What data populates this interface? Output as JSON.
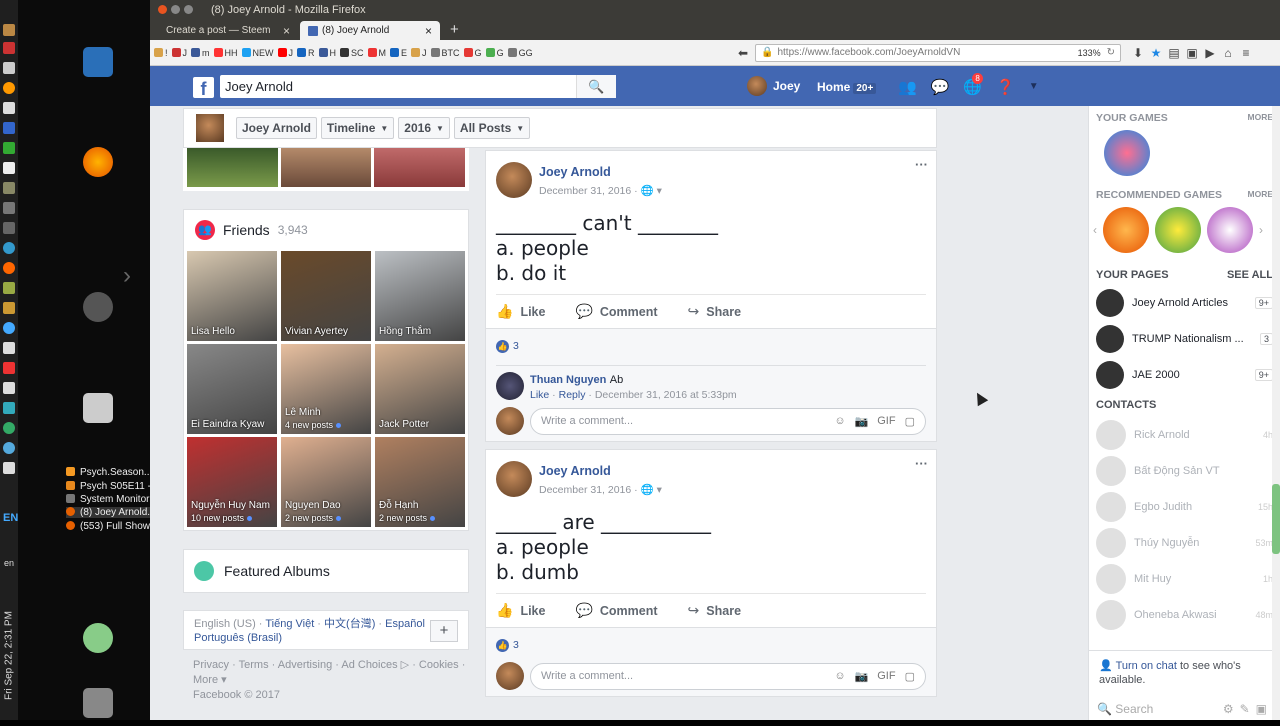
{
  "system": {
    "clock": "Fri Sep 22, 2:31 PM",
    "lang": "EN",
    "kb": "en"
  },
  "taskbar": {
    "items": [
      {
        "label": "Psych.Season....",
        "color": "#f59a23"
      },
      {
        "label": "Psych S05E11 -...",
        "color": "#e8891d"
      },
      {
        "label": "System Monitor",
        "color": "#777777"
      },
      {
        "label": "(8) Joey Arnold...",
        "color": "#e66000"
      },
      {
        "label": "(553) Full Show...",
        "color": "#e66000"
      }
    ]
  },
  "window": {
    "title": "(8) Joey Arnold - Mozilla Firefox"
  },
  "tabs": [
    {
      "label": "Create a post — Steem",
      "active": false
    },
    {
      "label": "(8) Joey Arnold",
      "active": true
    }
  ],
  "bookmarks": [
    "!",
    "J",
    "m",
    "HH",
    "NEW",
    "J",
    "R",
    "H",
    "SC",
    "M",
    "E",
    "J",
    "BTC",
    "G",
    "G",
    "GG"
  ],
  "url": {
    "value": "https://www.facebook.com/JoeyArnoldVN",
    "zoom": "133%"
  },
  "fb": {
    "search_value": "Joey Arnold",
    "user_name": "Joey",
    "home_label": "Home",
    "home_badge": "20+",
    "notif_count": "8"
  },
  "timeline": {
    "name": "Joey Arnold",
    "section": "Timeline",
    "year": "2016",
    "filter": "All Posts"
  },
  "friends": {
    "title": "Friends",
    "count": "3,943",
    "list": [
      {
        "name": "Lisa Hello",
        "note": ""
      },
      {
        "name": "Vivian Ayertey",
        "note": ""
      },
      {
        "name": "Hồng Thắm",
        "note": ""
      },
      {
        "name": "Ei Eaindra Kyaw",
        "note": ""
      },
      {
        "name": "Lê Minh",
        "note": "4 new posts"
      },
      {
        "name": "Jack Potter",
        "note": ""
      },
      {
        "name": "Nguyễn Huy Nam",
        "note": "10 new posts"
      },
      {
        "name": "Nguyen Dao",
        "note": "2 new posts"
      },
      {
        "name": "Đỗ Hạnh",
        "note": "2 new posts"
      }
    ]
  },
  "albums": {
    "title": "Featured Albums"
  },
  "languages": {
    "current": "English (US)",
    "links": [
      "Tiếng Việt",
      "中文(台灣)",
      "Español",
      "Português (Brasil)"
    ]
  },
  "footer": {
    "links": [
      "Privacy",
      "Terms",
      "Advertising",
      "Ad Choices",
      "Cookies",
      "More"
    ],
    "copyright": "Facebook © 2017"
  },
  "posts": [
    {
      "author": "Joey Arnold",
      "date": "December 31, 2016",
      "lines": [
        "________ can't ________",
        "a. people",
        "b. do it"
      ],
      "like_count": "3",
      "comment": {
        "author": "Thuan Nguyen",
        "text": "Ab",
        "time": "December 31, 2016 at 5:33pm"
      }
    },
    {
      "author": "Joey Arnold",
      "date": "December 31, 2016",
      "lines": [
        "______ are ___________",
        "a. people",
        "b. dumb"
      ],
      "like_count": "3"
    }
  ],
  "actions": {
    "like": "Like",
    "comment": "Comment",
    "share": "Share",
    "reply": "Reply",
    "write_comment": "Write a comment..."
  },
  "right": {
    "your_games": "YOUR GAMES",
    "recommended": "RECOMMENDED GAMES",
    "more": "MORE",
    "your_pages": "YOUR PAGES",
    "see_all": "SEE ALL",
    "pages": [
      {
        "name": "Joey Arnold Articles",
        "badge": "9+"
      },
      {
        "name": "TRUMP Nationalism ...",
        "badge": "3"
      },
      {
        "name": "JAE 2000",
        "badge": "9+"
      }
    ],
    "contacts_title": "CONTACTS",
    "contacts": [
      {
        "name": "Rick Arnold",
        "time": "4h"
      },
      {
        "name": "Bất Động Sản VT",
        "time": ""
      },
      {
        "name": "Egbo Judith",
        "time": "15h"
      },
      {
        "name": "Thúy Nguyễn",
        "time": "53m"
      },
      {
        "name": "Mit Huy",
        "time": "1h"
      },
      {
        "name": "Oheneba Akwasi",
        "time": "48m"
      }
    ],
    "chat_link": "Turn on chat",
    "chat_text": " to see who's available.",
    "search_placeholder": "Search"
  }
}
